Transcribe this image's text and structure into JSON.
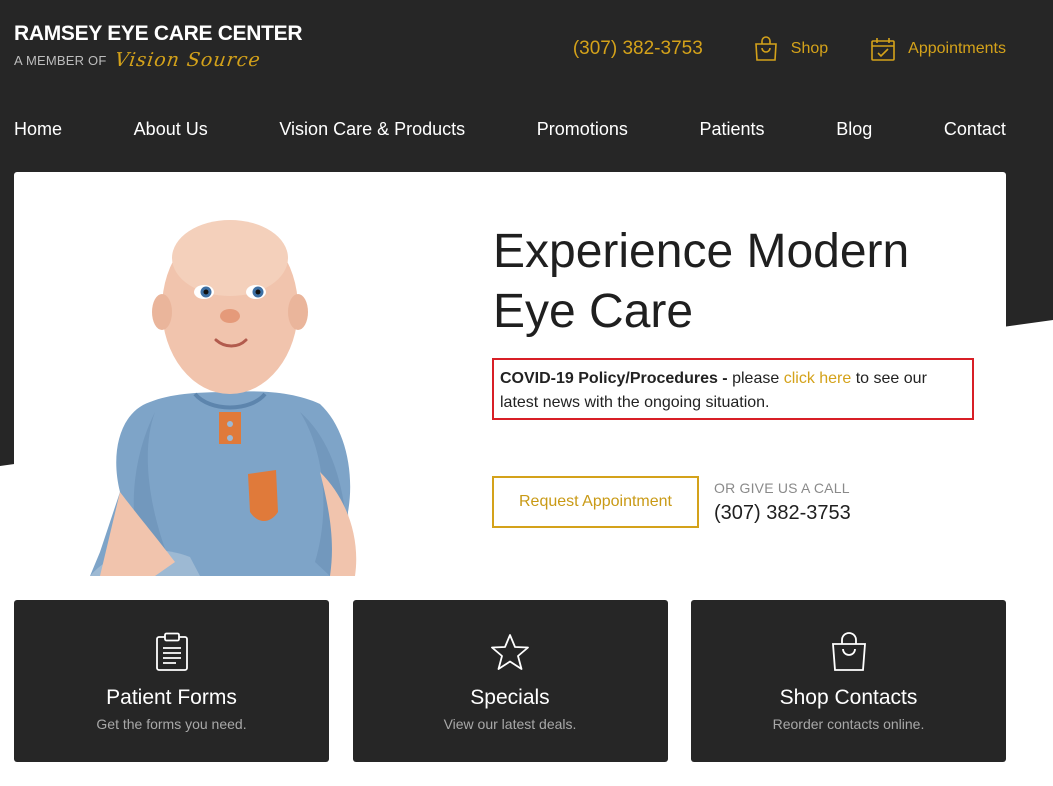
{
  "colors": {
    "accent": "#d4a21a",
    "dark": "#262626",
    "alert": "#d81f26"
  },
  "header": {
    "brand_name": "RAMSEY EYE CARE CENTER",
    "brand_member": "A MEMBER OF",
    "brand_partner": "Vision Source",
    "phone": "(307) 382-3753",
    "shop_label": "Shop",
    "shop_icon": "shopping-bag-icon",
    "appointments_label": "Appointments",
    "appointments_icon": "calendar-check-icon"
  },
  "nav": {
    "items": [
      "Home",
      "About Us",
      "Vision Care & Products",
      "Promotions",
      "Patients",
      "Blog",
      "Contact"
    ]
  },
  "hero": {
    "title": "Experience Modern Eye Care",
    "covid_bold": "COVID-19 Policy/Procedures -",
    "covid_pre": "please",
    "covid_link": "click here",
    "covid_post": "to see our latest news with the ongoing situation.",
    "cta_label": "Request Appointment",
    "call_label": "OR GIVE US A CALL",
    "call_phone": "(307) 382-3753"
  },
  "cards": [
    {
      "title": "Patient Forms",
      "subtitle": "Get the forms you need.",
      "icon": "clipboard-icon"
    },
    {
      "title": "Specials",
      "subtitle": "View our latest deals.",
      "icon": "star-icon"
    },
    {
      "title": "Shop Contacts",
      "subtitle": "Reorder contacts online.",
      "icon": "shopping-bag-icon"
    }
  ]
}
